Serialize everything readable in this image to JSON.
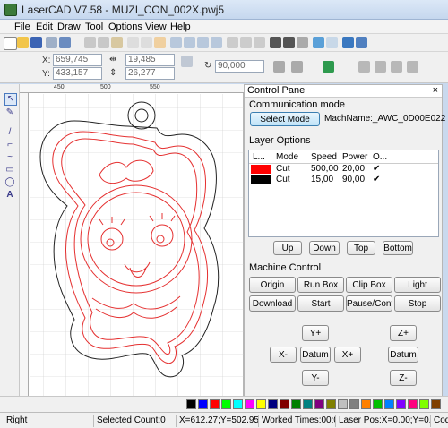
{
  "window": {
    "title": "LaserCAD V7.58 - MUZI_CON_002X.pwj5"
  },
  "menu": {
    "items": [
      "File",
      "Edit",
      "Draw",
      "Tool",
      "Options",
      "View",
      "Help"
    ]
  },
  "coords": {
    "x_label": "X:",
    "x_value": "659,745",
    "y_label": "Y:",
    "y_value": "433,157",
    "w_value": "19,485",
    "h_value": "26,277",
    "angle_value": "90,000"
  },
  "ruler": {
    "ticks": [
      "450",
      "500",
      "550"
    ]
  },
  "control_panel": {
    "title": "Control Panel",
    "close_glyph": "×",
    "communication_mode": "Communication mode",
    "select_mode": "Select Mode",
    "machine_name": "MachName:_AWC_0D00E022",
    "layer_options": "Layer Options",
    "layer_table": {
      "headers": [
        "L...",
        "Mode",
        "Speed",
        "Power",
        "O..."
      ],
      "rows": [
        {
          "color": "#ff0000",
          "mode": "Cut",
          "speed": "500,00",
          "power": "20,00",
          "output": "✔"
        },
        {
          "color": "#000000",
          "mode": "Cut",
          "speed": "15,00",
          "power": "90,00",
          "output": "✔"
        }
      ]
    },
    "layer_buttons": {
      "up": "Up",
      "down": "Down",
      "top": "Top",
      "bottom": "Bottom"
    },
    "machine_control": "Machine Control",
    "mc_buttons": {
      "origin": "Origin",
      "run_box": "Run Box",
      "clip_box": "Clip Box",
      "light": "Light",
      "download": "Download",
      "start": "Start",
      "pause": "Pause/Continue",
      "stop": "Stop"
    },
    "jog": {
      "y_plus": "Y+",
      "y_minus": "Y-",
      "x_minus": "X-",
      "x_plus": "X+",
      "datum": "Datum",
      "z_plus": "Z+",
      "z_minus": "Z-"
    }
  },
  "palette": {
    "colors": [
      "#000000",
      "#0000ff",
      "#ff0000",
      "#00ff00",
      "#00ffff",
      "#ff00ff",
      "#ffff00",
      "#000080",
      "#800000",
      "#008000",
      "#008080",
      "#800080",
      "#808000",
      "#c0c0c0",
      "#808080",
      "#ff8000",
      "#00c000",
      "#0080ff",
      "#8000ff",
      "#ff0080",
      "#80ff00",
      "#804000",
      "#ffffff"
    ]
  },
  "status": {
    "mode": "Right",
    "selected": "Selected Count:0",
    "position": "X=612.27;Y=502.95",
    "worked": "Worked Times:00:00",
    "laser_pos": "Laser Pos:X=0.00;Y=0.00",
    "cod": "Cod"
  },
  "colors": {
    "cut_line": "#e53030",
    "outline": "#222222"
  }
}
